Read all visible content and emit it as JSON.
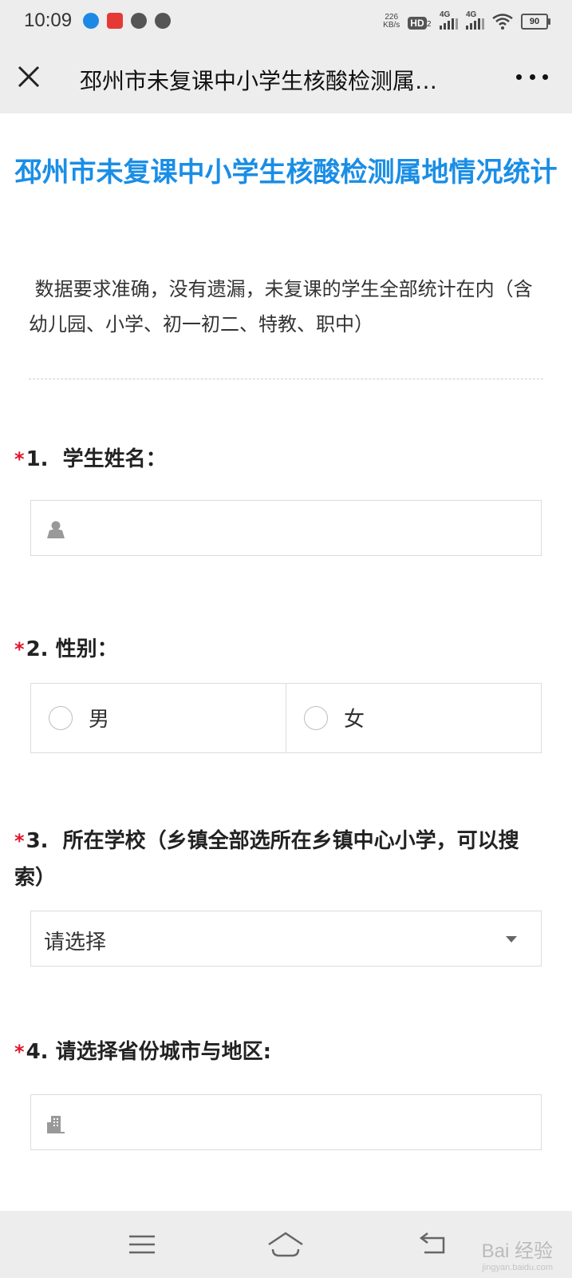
{
  "status_bar": {
    "time": "10:09",
    "net_speed_value": "226",
    "net_speed_unit": "KB/s",
    "hd_label": "HD",
    "hd_sub": "2",
    "signal1_label": "4G",
    "signal2_label": "4G",
    "battery": "90"
  },
  "nav": {
    "title": "邳州市未复课中小学生核酸检测属…"
  },
  "form": {
    "title": "邳州市未复课中小学生核酸检测属地情况统计",
    "description": "数据要求准确，没有遗漏，未复课的学生全部统计在内（含幼儿园、小学、初一初二、特教、职中）",
    "required_mark": "*",
    "questions": [
      {
        "number": "1.",
        "label": "学生姓名："
      },
      {
        "number": "2.",
        "label": "性别：",
        "options": [
          "男",
          "女"
        ]
      },
      {
        "number": "3.",
        "label": "所在学校（乡镇全部选所在乡镇中心小学，可以搜索）",
        "selected": "请选择"
      },
      {
        "number": "4.",
        "label": "请选择省份城市与地区:"
      }
    ]
  },
  "watermark": {
    "brand": "Bai 经验",
    "url": "jingyan.baidu.com"
  },
  "colors": {
    "title_blue": "#1a8ee6",
    "required_red": "#e0162b",
    "bar_gray": "#ededed"
  }
}
